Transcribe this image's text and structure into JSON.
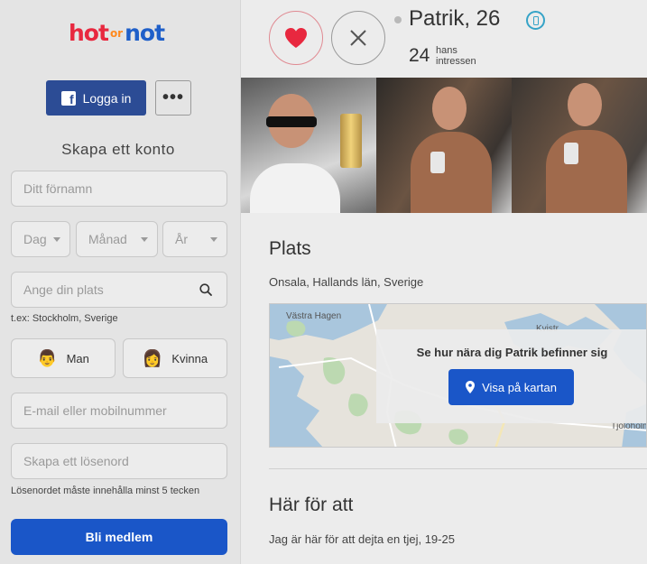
{
  "sidebar": {
    "logo": {
      "hot": "hot",
      "or": "or",
      "not": "not"
    },
    "facebook_login_label": "Logga in",
    "more_label": "•••",
    "signup_title": "Skapa ett konto",
    "first_name_placeholder": "Ditt förnamn",
    "day_label": "Dag",
    "month_label": "Månad",
    "year_label": "År",
    "location_placeholder": "Ange din plats",
    "location_hint": "t.ex: Stockholm, Sverige",
    "gender_male": {
      "emoji": "👨",
      "label": "Man"
    },
    "gender_female": {
      "emoji": "👩",
      "label": "Kvinna"
    },
    "email_placeholder": "E-mail eller mobilnummer",
    "password_placeholder": "Skapa ett lösenord",
    "password_hint": "Lösenordet måste innehålla minst 5 tecken",
    "join_label": "Bli medlem"
  },
  "profile": {
    "name_age": "Patrik, 26",
    "interests_count": "24",
    "interests_label": "hans intressen",
    "verified_icon": "phone-icon"
  },
  "location_section": {
    "title": "Plats",
    "location": "Onsala, Hallands län, Sverige",
    "map_labels": [
      "Västra Hagen",
      "Kvistr",
      "Tjolöholm"
    ],
    "map_cta": "Se hur nära dig Patrik befinner sig",
    "map_button_label": "Visa på kartan"
  },
  "here_for_section": {
    "title": "Här för att",
    "text": "Jag är här för att dejta en tjej, 19-25"
  },
  "colors": {
    "brand_blue": "#1a56c8",
    "facebook_blue": "#2c4c95",
    "like_red": "#e8283f",
    "verified_teal": "#35a3c7"
  }
}
